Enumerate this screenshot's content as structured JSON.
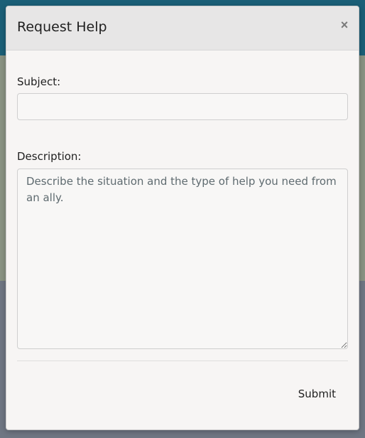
{
  "modal": {
    "title": "Request Help",
    "close_symbol": "×",
    "close_icon": "close-icon"
  },
  "form": {
    "subject": {
      "label": "Subject:",
      "value": "",
      "placeholder": ""
    },
    "description": {
      "label": "Description:",
      "value": "",
      "placeholder": "Describe the situation and the type of help you need from an ally."
    },
    "submit_label": "Submit"
  },
  "colors": {
    "header_bg": "#e7e6e6",
    "modal_bg": "#f7f5f4",
    "backdrop_top": "#1b5f77",
    "backdrop_mid": "#8a9383",
    "backdrop_bottom": "#6f7683"
  }
}
